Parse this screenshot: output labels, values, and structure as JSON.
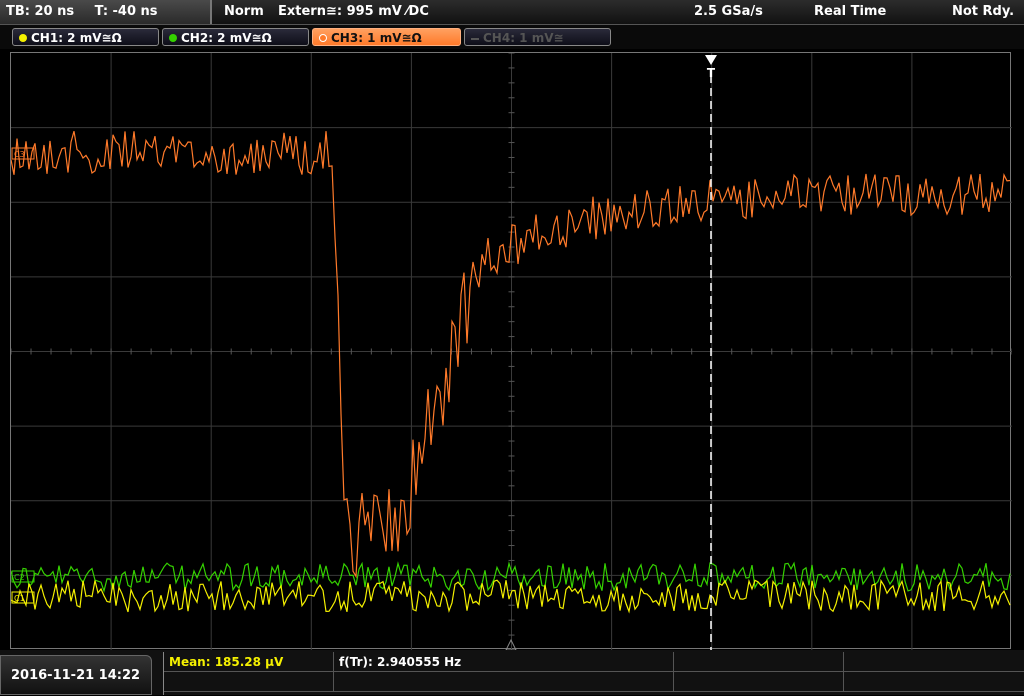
{
  "topbar": {
    "timebase": "TB: 20 ns",
    "trigger_offset": "T: -40 ns",
    "mode": "Norm",
    "trigger": "Extern≅: 995 mV ⁄DC",
    "sample_rate": "2.5 GSa/s",
    "acquisition": "Real Time",
    "status": "Not Rdy."
  },
  "channels": [
    {
      "label": "CH1: 2 mV≅Ω",
      "color": "#f4f000",
      "active": true
    },
    {
      "label": "CH2: 2 mV≅Ω",
      "color": "#35d200",
      "active": true
    },
    {
      "label": "CH3: 1 mV≅Ω",
      "color": "#ff7a2a",
      "active": true,
      "selected": true
    },
    {
      "label": "CH4: 1 mV≅",
      "color": "#666666",
      "active": false
    }
  ],
  "markers": {
    "trigger_label": "T",
    "ch3_ref": "C3",
    "ch2_ref": "C2",
    "ch1_ref": "C1"
  },
  "footer": {
    "datetime": "2016-11-21 14:22",
    "mean": "Mean: 185.28 µV",
    "freq": "f(Tr): 2.940555 Hz"
  },
  "colors": {
    "ch1": "#f4f000",
    "ch2": "#35d200",
    "ch3": "#ff7a2a",
    "grid": "#3a3a3a",
    "trigger_line": "#ffffff"
  }
}
